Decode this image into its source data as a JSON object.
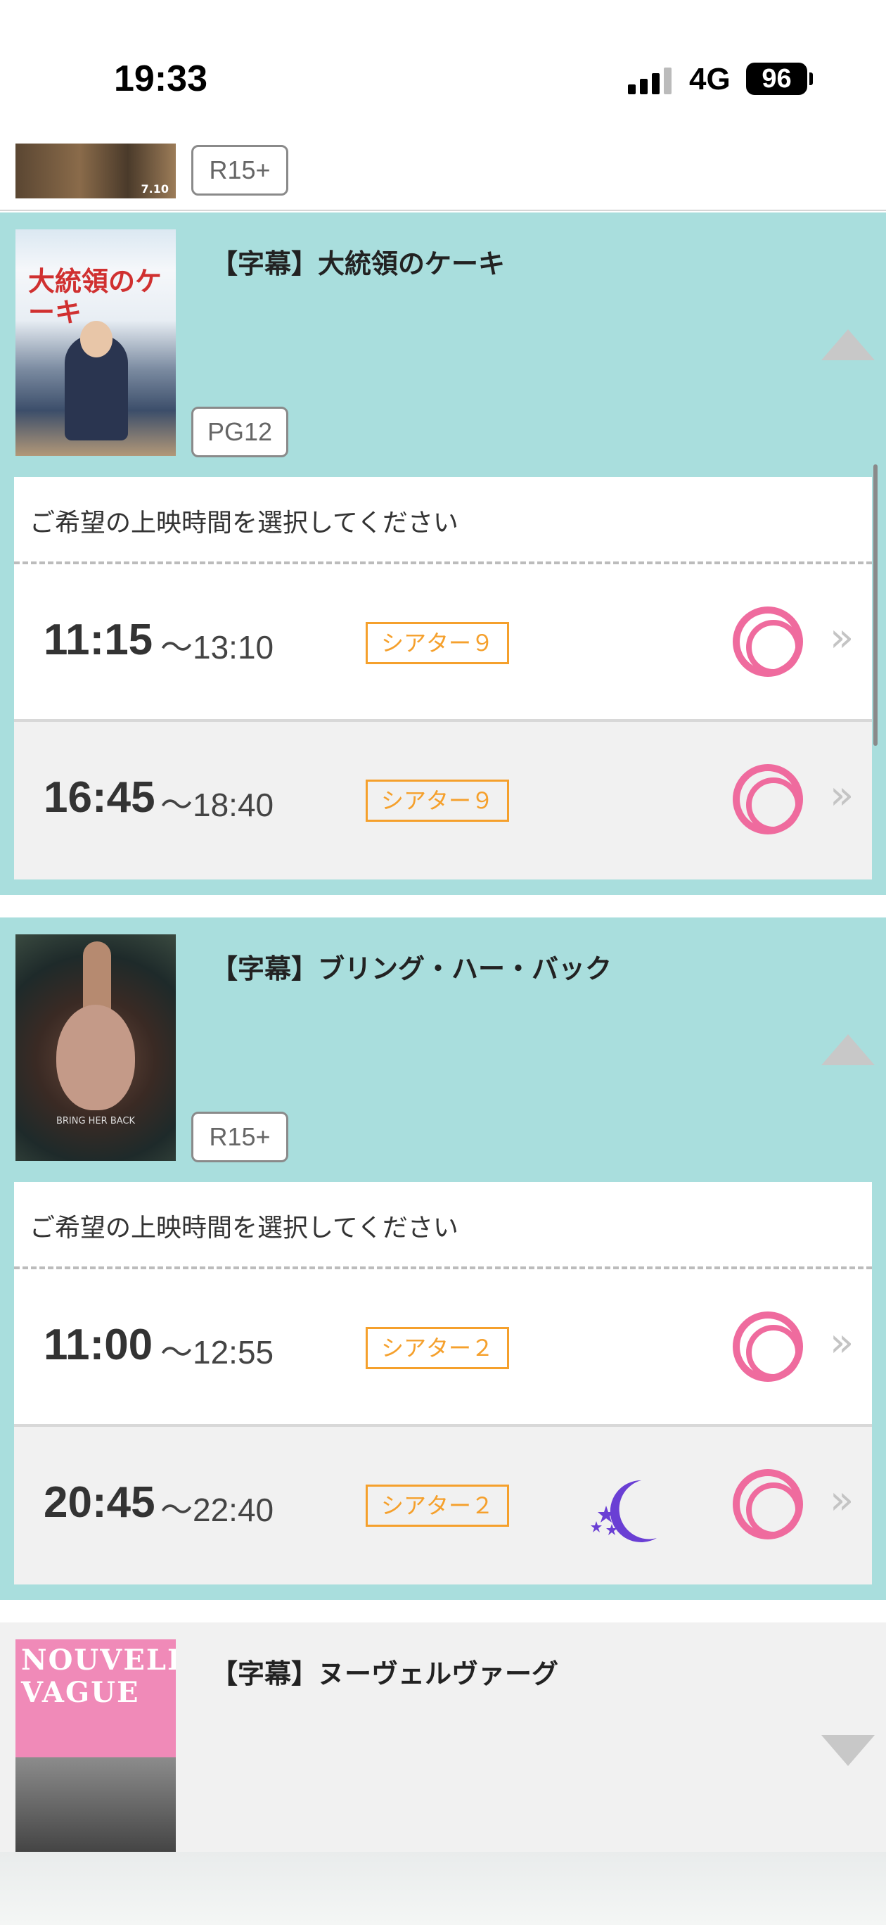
{
  "status_bar": {
    "time": "19:33",
    "network": "4G",
    "battery": "96"
  },
  "top_item": {
    "rating": "R15+",
    "poster_date": "7.10"
  },
  "panel_prompt": "ご希望の上映時間を選択してください",
  "movies": [
    {
      "title": "【字幕】大統領のケーキ",
      "rating": "PG12",
      "poster_title": "大統領のケーキ",
      "showtimes": [
        {
          "start": "11:15",
          "end": "〜13:10",
          "theater": "シアター９",
          "late_show": false
        },
        {
          "start": "16:45",
          "end": "〜18:40",
          "theater": "シアター９",
          "late_show": false
        }
      ]
    },
    {
      "title": "【字幕】ブリング・ハー・バック",
      "rating": "R15+",
      "poster_caption": "BRING HER BACK",
      "showtimes": [
        {
          "start": "11:00",
          "end": "〜12:55",
          "theater": "シアター２",
          "late_show": false
        },
        {
          "start": "20:45",
          "end": "〜22:40",
          "theater": "シアター２",
          "late_show": true
        }
      ]
    },
    {
      "title": "【字幕】ヌーヴェルヴァーグ",
      "poster_lines": [
        "NOUVELLE",
        "VAGUE"
      ]
    }
  ],
  "icons": {
    "availability": "double-circle-icon",
    "late_show": "moon-stars-icon",
    "chevron": "double-chevron-right-icon"
  },
  "colors": {
    "accent_bg": "#a9dedd",
    "availability": "#ef6b9e",
    "theater_tag": "#f5a02c"
  }
}
